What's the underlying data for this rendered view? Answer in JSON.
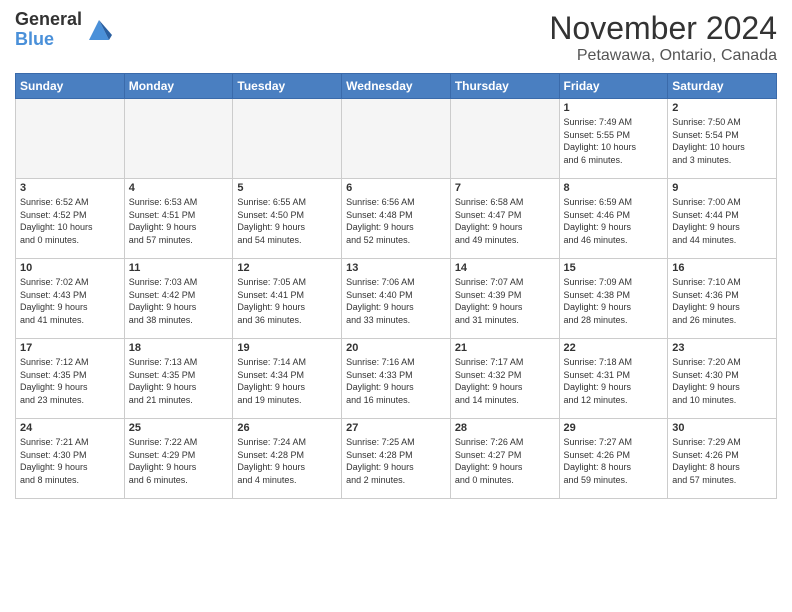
{
  "header": {
    "logo_general": "General",
    "logo_blue": "Blue",
    "title": "November 2024",
    "location": "Petawawa, Ontario, Canada"
  },
  "columns": [
    "Sunday",
    "Monday",
    "Tuesday",
    "Wednesday",
    "Thursday",
    "Friday",
    "Saturday"
  ],
  "weeks": [
    [
      {
        "day": "",
        "info": ""
      },
      {
        "day": "",
        "info": ""
      },
      {
        "day": "",
        "info": ""
      },
      {
        "day": "",
        "info": ""
      },
      {
        "day": "",
        "info": ""
      },
      {
        "day": "1",
        "info": "Sunrise: 7:49 AM\nSunset: 5:55 PM\nDaylight: 10 hours\nand 6 minutes."
      },
      {
        "day": "2",
        "info": "Sunrise: 7:50 AM\nSunset: 5:54 PM\nDaylight: 10 hours\nand 3 minutes."
      }
    ],
    [
      {
        "day": "3",
        "info": "Sunrise: 6:52 AM\nSunset: 4:52 PM\nDaylight: 10 hours\nand 0 minutes."
      },
      {
        "day": "4",
        "info": "Sunrise: 6:53 AM\nSunset: 4:51 PM\nDaylight: 9 hours\nand 57 minutes."
      },
      {
        "day": "5",
        "info": "Sunrise: 6:55 AM\nSunset: 4:50 PM\nDaylight: 9 hours\nand 54 minutes."
      },
      {
        "day": "6",
        "info": "Sunrise: 6:56 AM\nSunset: 4:48 PM\nDaylight: 9 hours\nand 52 minutes."
      },
      {
        "day": "7",
        "info": "Sunrise: 6:58 AM\nSunset: 4:47 PM\nDaylight: 9 hours\nand 49 minutes."
      },
      {
        "day": "8",
        "info": "Sunrise: 6:59 AM\nSunset: 4:46 PM\nDaylight: 9 hours\nand 46 minutes."
      },
      {
        "day": "9",
        "info": "Sunrise: 7:00 AM\nSunset: 4:44 PM\nDaylight: 9 hours\nand 44 minutes."
      }
    ],
    [
      {
        "day": "10",
        "info": "Sunrise: 7:02 AM\nSunset: 4:43 PM\nDaylight: 9 hours\nand 41 minutes."
      },
      {
        "day": "11",
        "info": "Sunrise: 7:03 AM\nSunset: 4:42 PM\nDaylight: 9 hours\nand 38 minutes."
      },
      {
        "day": "12",
        "info": "Sunrise: 7:05 AM\nSunset: 4:41 PM\nDaylight: 9 hours\nand 36 minutes."
      },
      {
        "day": "13",
        "info": "Sunrise: 7:06 AM\nSunset: 4:40 PM\nDaylight: 9 hours\nand 33 minutes."
      },
      {
        "day": "14",
        "info": "Sunrise: 7:07 AM\nSunset: 4:39 PM\nDaylight: 9 hours\nand 31 minutes."
      },
      {
        "day": "15",
        "info": "Sunrise: 7:09 AM\nSunset: 4:38 PM\nDaylight: 9 hours\nand 28 minutes."
      },
      {
        "day": "16",
        "info": "Sunrise: 7:10 AM\nSunset: 4:36 PM\nDaylight: 9 hours\nand 26 minutes."
      }
    ],
    [
      {
        "day": "17",
        "info": "Sunrise: 7:12 AM\nSunset: 4:35 PM\nDaylight: 9 hours\nand 23 minutes."
      },
      {
        "day": "18",
        "info": "Sunrise: 7:13 AM\nSunset: 4:35 PM\nDaylight: 9 hours\nand 21 minutes."
      },
      {
        "day": "19",
        "info": "Sunrise: 7:14 AM\nSunset: 4:34 PM\nDaylight: 9 hours\nand 19 minutes."
      },
      {
        "day": "20",
        "info": "Sunrise: 7:16 AM\nSunset: 4:33 PM\nDaylight: 9 hours\nand 16 minutes."
      },
      {
        "day": "21",
        "info": "Sunrise: 7:17 AM\nSunset: 4:32 PM\nDaylight: 9 hours\nand 14 minutes."
      },
      {
        "day": "22",
        "info": "Sunrise: 7:18 AM\nSunset: 4:31 PM\nDaylight: 9 hours\nand 12 minutes."
      },
      {
        "day": "23",
        "info": "Sunrise: 7:20 AM\nSunset: 4:30 PM\nDaylight: 9 hours\nand 10 minutes."
      }
    ],
    [
      {
        "day": "24",
        "info": "Sunrise: 7:21 AM\nSunset: 4:30 PM\nDaylight: 9 hours\nand 8 minutes."
      },
      {
        "day": "25",
        "info": "Sunrise: 7:22 AM\nSunset: 4:29 PM\nDaylight: 9 hours\nand 6 minutes."
      },
      {
        "day": "26",
        "info": "Sunrise: 7:24 AM\nSunset: 4:28 PM\nDaylight: 9 hours\nand 4 minutes."
      },
      {
        "day": "27",
        "info": "Sunrise: 7:25 AM\nSunset: 4:28 PM\nDaylight: 9 hours\nand 2 minutes."
      },
      {
        "day": "28",
        "info": "Sunrise: 7:26 AM\nSunset: 4:27 PM\nDaylight: 9 hours\nand 0 minutes."
      },
      {
        "day": "29",
        "info": "Sunrise: 7:27 AM\nSunset: 4:26 PM\nDaylight: 8 hours\nand 59 minutes."
      },
      {
        "day": "30",
        "info": "Sunrise: 7:29 AM\nSunset: 4:26 PM\nDaylight: 8 hours\nand 57 minutes."
      }
    ]
  ]
}
